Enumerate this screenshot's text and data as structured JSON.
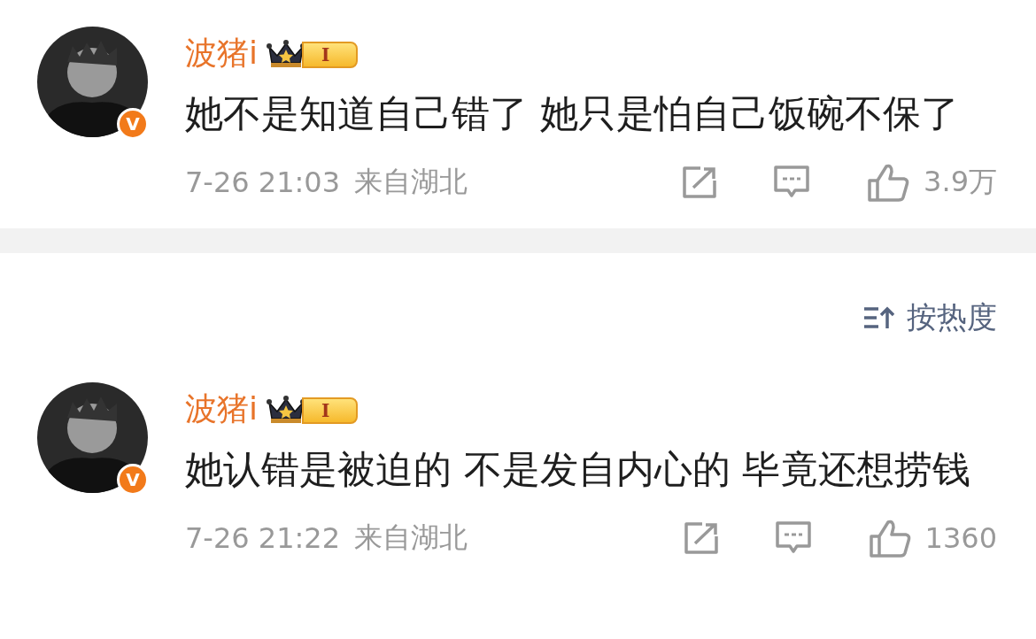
{
  "comments": [
    {
      "username": "波猪i",
      "level_badge": "I",
      "verified_mark": "V",
      "text": "她不是知道自己错了 她只是怕自己饭碗不保了",
      "time": "7-26 21:03",
      "location": "来自湖北",
      "likes": "3.9万"
    },
    {
      "username": "波猪i",
      "level_badge": "I",
      "verified_mark": "V",
      "text": "她认错是被迫的 不是发自内心的 毕竟还想捞钱",
      "time": "7-26 21:22",
      "location": "来自湖北",
      "likes": "1360"
    }
  ],
  "sort": {
    "label": "按热度"
  }
}
